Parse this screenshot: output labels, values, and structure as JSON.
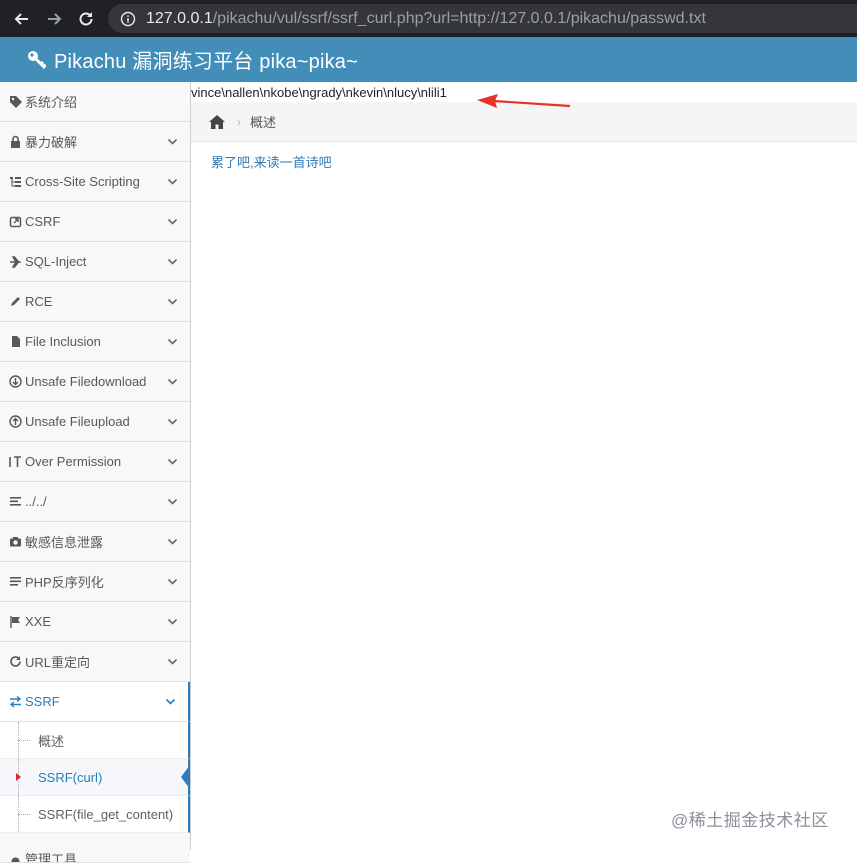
{
  "browser": {
    "url_host": "127.0.0.1",
    "url_rest": "/pikachu/vul/ssrf/ssrf_curl.php?url=http://127.0.0.1/pikachu/passwd.txt"
  },
  "app": {
    "title": "Pikachu 漏洞练习平台 pika~pika~"
  },
  "sidebar": {
    "items": [
      {
        "label": "系统介绍",
        "icon": "tag-icon"
      },
      {
        "label": "暴力破解",
        "icon": "lock-icon"
      },
      {
        "label": "Cross-Site Scripting",
        "icon": "sitemap-icon"
      },
      {
        "label": "CSRF",
        "icon": "share-icon"
      },
      {
        "label": "SQL-Inject",
        "icon": "plane-icon"
      },
      {
        "label": "RCE",
        "icon": "pencil-icon"
      },
      {
        "label": "File Inclusion",
        "icon": "file-icon"
      },
      {
        "label": "Unsafe Filedownload",
        "icon": "download-icon"
      },
      {
        "label": "Unsafe Fileupload",
        "icon": "upload-icon"
      },
      {
        "label": "Over Permission",
        "icon": "text-height-icon"
      },
      {
        "label": "../../",
        "icon": "list-icon"
      },
      {
        "label": "敏感信息泄露",
        "icon": "camera-icon"
      },
      {
        "label": "PHP反序列化",
        "icon": "align-icon"
      },
      {
        "label": "XXE",
        "icon": "flag-icon"
      },
      {
        "label": "URL重定向",
        "icon": "refresh-icon"
      },
      {
        "label": "SSRF",
        "icon": "exchange-icon"
      }
    ],
    "ssrf_sub": [
      "概述",
      "SSRF(curl)",
      "SSRF(file_get_content)"
    ],
    "partial_next": "管理工具"
  },
  "main": {
    "output_text": "vince\\nallen\\nkobe\\ngrady\\nkevin\\nlucy\\nlili1",
    "breadcrumb": "概述",
    "poem_link": "累了吧,来读一首诗吧"
  },
  "watermark": "@稀土掘金技术社区",
  "colors": {
    "header": "#438eb9",
    "accent": "#2b7dbc",
    "arrow": "#e8332a"
  }
}
